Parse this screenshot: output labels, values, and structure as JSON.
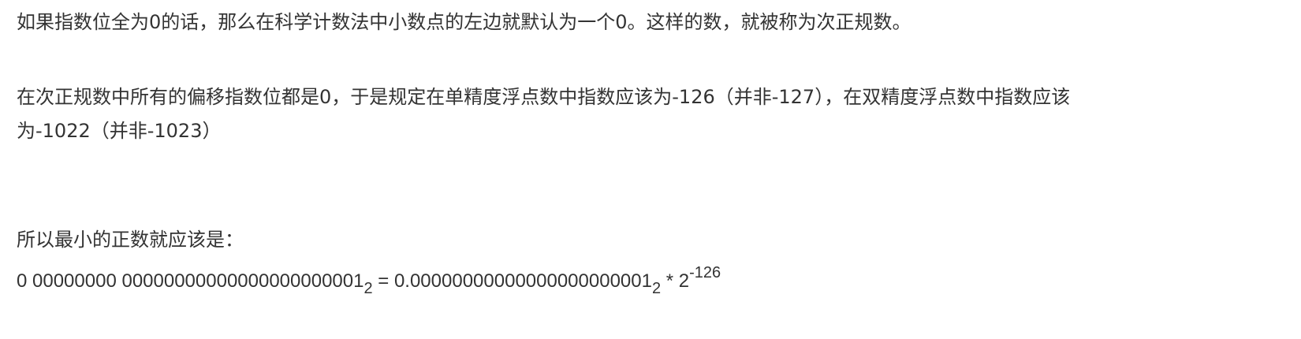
{
  "paragraphs": {
    "p1": "如果指数位全为0的话，那么在科学计数法中小数点的左边就默认为一个0。这样的数，就被称为次正规数。",
    "p2_line1": "在次正规数中所有的偏移指数位都是0，于是规定在单精度浮点数中指数应该为-126（并非-127），在双精度浮点数中指数应该",
    "p2_line2": "为-1022（并非-1023）",
    "p3": "所以最小的正数就应该是："
  },
  "formula": {
    "lhs": "0 00000000 00000000000000000000001",
    "lhs_sub": "2",
    "eq": " = 0.00000000000000000000001",
    "rhs_sub": "2",
    "times": " * 2",
    "exp": "-126"
  }
}
